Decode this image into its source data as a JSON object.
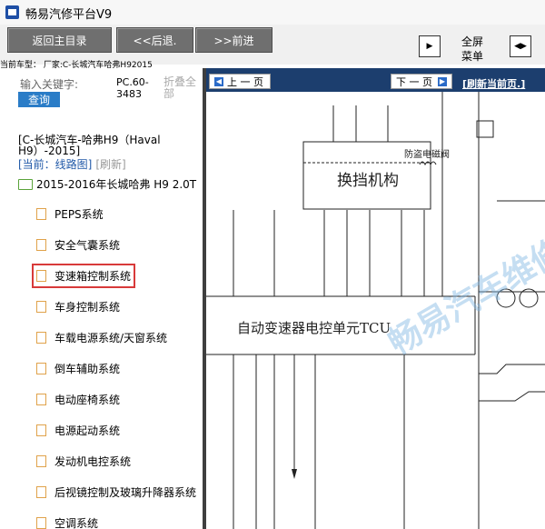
{
  "window": {
    "title": "畅易汽修平台V9"
  },
  "toolbar": {
    "back_main": "返回主目录",
    "back": "<<后退.",
    "forward": ">>前进",
    "fullscreen_line1": "全屏",
    "fullscreen_line2": "菜单"
  },
  "current_vehicle": "当前车型： 厂家:C-长城汽车哈弗H92015",
  "sidebar": {
    "search_placeholder": "输入关键字:",
    "search_button": "查询",
    "page_code_line1": "PC.60-",
    "page_code_line2": "3483",
    "collapse_line1": "折叠全",
    "collapse_line2": "部",
    "path_text": "[C-长城汽车-哈弗H9（Haval H9）-2015]",
    "crumb_current": "[当前：线路图]",
    "crumb_refresh": "[刷新]",
    "folder": "2015-2016年长城哈弗 H9 2.0T",
    "items": [
      {
        "label": "PEPS系统"
      },
      {
        "label": "安全气囊系统"
      },
      {
        "label": "变速箱控制系统"
      },
      {
        "label": "车身控制系统"
      },
      {
        "label": "车载电源系统/天窗系统"
      },
      {
        "label": "倒车辅助系统"
      },
      {
        "label": "电动座椅系统"
      },
      {
        "label": "电源起动系统"
      },
      {
        "label": "发动机电控系统"
      },
      {
        "label": "后视镜控制及玻璃升降器系统"
      },
      {
        "label": "空调系统"
      }
    ]
  },
  "viewer": {
    "prev_page": "上 一 页",
    "next_page": "下 一 页",
    "refresh_page": "[刷新当前页.]",
    "diagram": {
      "shift_mechanism": "换挡机构",
      "anti_theft": "防盗电磁阀",
      "tcu": "自动变速器电控单元TCU",
      "watermark": "畅易汽车维修"
    }
  },
  "colors": {
    "navbar": "#1c3e6e",
    "search_button": "#2a7cc7",
    "highlight": "#d83a3a",
    "toolbar_button": "#6f6f6f"
  }
}
